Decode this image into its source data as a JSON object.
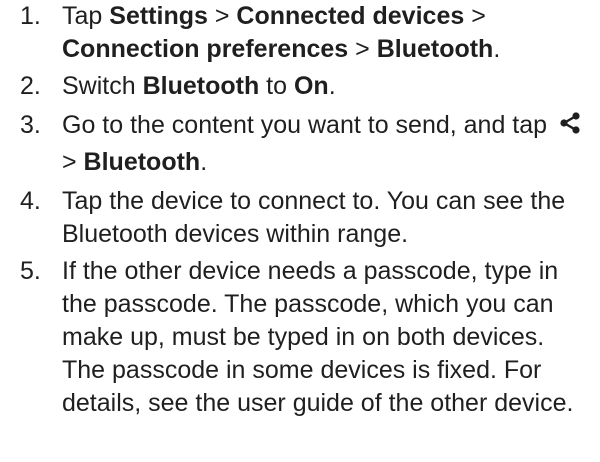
{
  "steps": [
    {
      "num": "1.",
      "t1": "Tap ",
      "b1": "Settings",
      "t2": " > ",
      "b2": "Connected devices",
      "t3": " > ",
      "b3": "Connection preferences",
      "t4": " > ",
      "b4": "Bluetooth",
      "t5": "."
    },
    {
      "num": "2.",
      "t1": "Switch ",
      "b1": "Bluetooth",
      "t2": " to ",
      "b2": "On",
      "t3": "."
    },
    {
      "num": "3.",
      "t1": "Go to the content you want to send, and tap ",
      "icon": "share-icon",
      "t2": " > ",
      "b1": "Bluetooth",
      "t3": "."
    },
    {
      "num": "4.",
      "text": "Tap the device to connect to. You can see the Bluetooth devices within range."
    },
    {
      "num": "5.",
      "text": "If the other device needs a passcode, type in the passcode. The passcode, which you can make up, must be typed in on both devices. The passcode in some devices is fixed. For details, see the user guide of the other device."
    }
  ]
}
